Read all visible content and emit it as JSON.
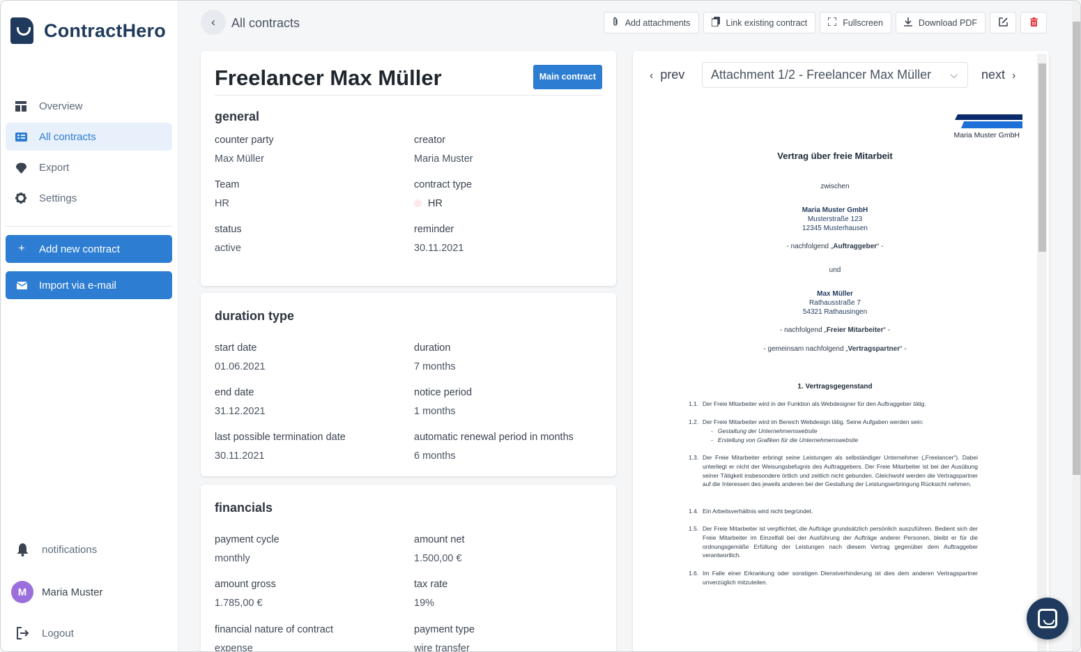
{
  "app": {
    "name": "ContractHero"
  },
  "sidebar": {
    "items": [
      {
        "label": "Overview",
        "icon": "dashboard-icon"
      },
      {
        "label": "All contracts",
        "icon": "contracts-list-icon"
      },
      {
        "label": "Export",
        "icon": "export-icon"
      },
      {
        "label": "Settings",
        "icon": "gear-icon"
      }
    ],
    "add_contract": "Add new contract",
    "import_email": "Import via e-mail",
    "notifications": "notifications",
    "user": {
      "initial": "M",
      "name": "Maria Muster"
    },
    "logout": "Logout"
  },
  "header": {
    "breadcrumb": "All contracts",
    "toolbar": {
      "add_attachments": "Add attachments",
      "link_contract": "Link existing contract",
      "fullscreen": "Fullscreen",
      "download_pdf": "Download PDF"
    }
  },
  "contract": {
    "title": "Freelancer Max Müller",
    "badge": "Main contract",
    "general": {
      "heading": "general",
      "counter_party_label": "counter party",
      "counter_party": "Max Müller",
      "creator_label": "creator",
      "creator": "Maria Muster",
      "team_label": "Team",
      "team": "HR",
      "contract_type_label": "contract type",
      "contract_type": "HR",
      "status_label": "status",
      "status": "active",
      "reminder_label": "reminder",
      "reminder": "30.11.2021"
    },
    "duration": {
      "heading": "duration type",
      "start_label": "start date",
      "start": "01.06.2021",
      "duration_label": "duration",
      "duration": "7 months",
      "end_label": "end date",
      "end": "31.12.2021",
      "notice_label": "notice period",
      "notice": "1 months",
      "last_term_label": "last possible termination date",
      "last_term": "30.11.2021",
      "renewal_label": "automatic renewal period in months",
      "renewal": "6 months"
    },
    "financials": {
      "heading": "financials",
      "cycle_label": "payment cycle",
      "cycle": "monthly",
      "net_label": "amount net",
      "net": "1.500,00 €",
      "gross_label": "amount gross",
      "gross": "1.785,00 €",
      "tax_label": "tax rate",
      "tax": "19%",
      "nature_label": "financial nature of contract",
      "nature": "expense",
      "ptype_label": "payment type",
      "ptype": "wire transfer"
    }
  },
  "viewer": {
    "prev": "prev",
    "next": "next",
    "attachment": "Attachment 1/2 - Freelancer Max Müller",
    "doc": {
      "company": "Maria Muster GmbH",
      "title": "Vertrag über freie Mitarbeit",
      "between": "zwischen",
      "party1_name": "Maria Muster GmbH",
      "party1_street": "Musterstraße 123",
      "party1_city": "12345 Musterhausen",
      "party1_role_pre": "- nachfolgend „",
      "party1_role": "Auftraggeber",
      "party1_role_post": "“ -",
      "and": "und",
      "party2_name": "Max Müller",
      "party2_street": "Rathausstraße 7",
      "party2_city": "54321 Rathausingen",
      "party2_role_pre": "- nachfolgend „",
      "party2_role": "Freier Mitarbeiter",
      "party2_role_post": "“ -",
      "joint_pre": "- gemeinsam nachfolgend „",
      "joint": "Vertragspartner",
      "joint_post": "“ -",
      "section": "1.   Vertragsgegenstand",
      "p1_num": "1.1.",
      "p1": "Der Freie Mitarbeiter wird in der Funktion als Webdesigner für den Auftraggeber tätig.",
      "p2_num": "1.2.",
      "p2": "Der Freie Mitarbeiter wird im Bereich Webdesign tätig. Seine Aufgaben werden sein:",
      "p2_b1": "Gestaltung der Unternehmenswebsite",
      "p2_b2": "Erstellung von Grafiken für die Unternehmenswebsite",
      "p3_num": "1.3.",
      "p3": "Der Freie Mitarbeiter erbringt seine Leistungen als selbständiger Unternehmer („Freelancer“). Dabei unterliegt er nicht der Weisungsbefugnis des Auftraggebers. Der Freie Mitarbeiter ist bei der Ausübung seiner Tätigkeit insbesondere örtlich und zeitlich nicht gebunden. Gleichwohl werden die Vertragspartner auf die Interessen des jeweils anderen bei der Gestaltung der Leistungserbringung Rücksicht nehmen.",
      "p4_num": "1.4.",
      "p4": "Ein Arbeitsverhältnis wird nicht begründet.",
      "p5_num": "1.5.",
      "p5": "Der Freie Mitarbeiter ist verpflichtet, die Aufträge grundsätzlich persönlich auszuführen. Bedient sich der Freie Mitarbeiter im Einzelfall bei der Ausführung der Aufträge anderer Personen, bleibt er für die ordnungsgemäße Erfüllung der Leistungen nach diesem Vertrag gegenüber dem Auftraggeber verantwortlich.",
      "p6_num": "1.6.",
      "p6": "Im Falle einer Erkrankung oder sonstigen Dienstverhinderung ist dies dem anderen Vertragspartner unverzüglich mitzuteilen."
    }
  },
  "colors": {
    "accent": "#2d7dd2",
    "brand": "#1f3a5c",
    "danger": "#e0353d",
    "avatar": "#9b6fdc"
  }
}
